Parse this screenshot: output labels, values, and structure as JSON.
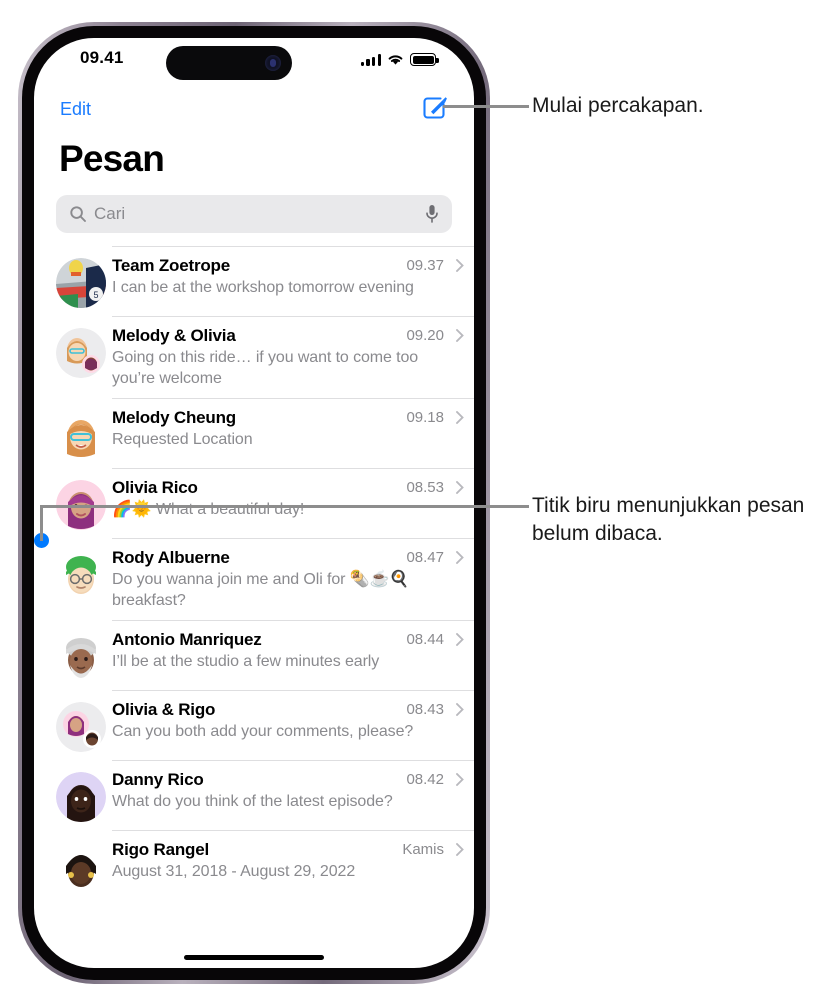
{
  "status_bar": {
    "time": "09.41",
    "signal_icon": "cellular-bars-icon",
    "wifi_icon": "wifi-icon",
    "battery_icon": "battery-full-icon"
  },
  "nav": {
    "edit_label": "Edit",
    "compose_icon": "compose-message-icon"
  },
  "header": {
    "title": "Pesan"
  },
  "search": {
    "placeholder": "Cari",
    "value": "",
    "search_icon": "search-icon",
    "mic_icon": "microphone-icon"
  },
  "conversations": [
    {
      "name": "Team Zoetrope",
      "time": "09.37",
      "preview": "I can be at the workshop tomorrow evening",
      "avatar_kind": "photo-collage",
      "unread": false
    },
    {
      "name": "Melody & Olivia",
      "time": "09.20",
      "preview": "Going on this ride… if you want to come too you’re welcome",
      "avatar_kind": "group-memoji",
      "unread": false
    },
    {
      "name": "Melody Cheung",
      "time": "09.18",
      "preview": "Requested Location",
      "avatar_kind": "memoji-melody",
      "unread": false
    },
    {
      "name": "Olivia Rico",
      "time": "08.53",
      "preview": "🌈🌞 What a beautiful day!",
      "avatar_kind": "memoji-olivia",
      "unread": true
    },
    {
      "name": "Rody Albuerne",
      "time": "08.47",
      "preview": "Do you wanna join me and Oli for 🌯☕️🍳 breakfast?",
      "avatar_kind": "memoji-rody",
      "unread": false
    },
    {
      "name": "Antonio Manriquez",
      "time": "08.44",
      "preview": "I’ll be at the studio a few minutes early",
      "avatar_kind": "memoji-antonio",
      "unread": false
    },
    {
      "name": "Olivia & Rigo",
      "time": "08.43",
      "preview": "Can you both add your comments, please?",
      "avatar_kind": "group-memoji-2",
      "unread": false
    },
    {
      "name": "Danny Rico",
      "time": "08.42",
      "preview": "What do you think of the latest episode?",
      "avatar_kind": "memoji-danny",
      "unread": false
    },
    {
      "name": "Rigo Rangel",
      "time": "Kamis",
      "preview": "August 31, 2018 - August 29, 2022",
      "avatar_kind": "memoji-rigo",
      "unread": false
    }
  ],
  "annotations": [
    {
      "text": "Mulai percakapan."
    },
    {
      "text": "Titik biru menunjukkan pesan belum dibaca."
    }
  ],
  "colors": {
    "accent_blue": "#007aff",
    "link_blue": "#1a7cff",
    "secondary_text": "#8a8a8e",
    "separator": "#dedee0",
    "search_bg": "#e9e9eb",
    "callout_line": "#8d8d8d"
  }
}
